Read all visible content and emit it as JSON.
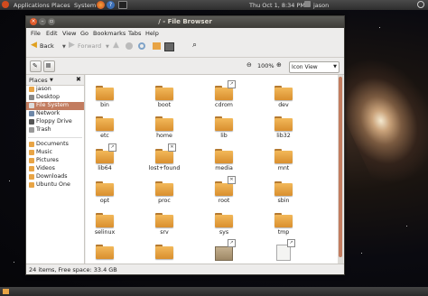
{
  "top_panel": {
    "menus": [
      "Applications",
      "Places",
      "System"
    ],
    "datetime": "Thu Oct 1,  8:34 PM",
    "user": "jason"
  },
  "window": {
    "title": "/ - File Browser",
    "menubar": [
      "File",
      "Edit",
      "View",
      "Go",
      "Bookmarks",
      "Tabs",
      "Help"
    ],
    "toolbar": {
      "back": "Back",
      "forward": "Forward"
    },
    "zoom": "100%",
    "view_mode": "Icon View",
    "sidebar": {
      "header": "Places",
      "items": [
        {
          "label": "jason",
          "icon": "home-icon"
        },
        {
          "label": "Desktop",
          "icon": "desktop-icon"
        },
        {
          "label": "File System",
          "icon": "drive-icon",
          "selected": true
        },
        {
          "label": "Network",
          "icon": "network-icon"
        },
        {
          "label": "Floppy Drive",
          "icon": "floppy-icon"
        },
        {
          "label": "Trash",
          "icon": "trash-icon"
        }
      ],
      "bookmarks": [
        {
          "label": "Documents"
        },
        {
          "label": "Music"
        },
        {
          "label": "Pictures"
        },
        {
          "label": "Videos"
        },
        {
          "label": "Downloads"
        },
        {
          "label": "Ubuntu One"
        }
      ]
    },
    "files": [
      {
        "name": "bin"
      },
      {
        "name": "boot"
      },
      {
        "name": "cdrom",
        "emblem": true
      },
      {
        "name": "dev"
      },
      {
        "name": "etc"
      },
      {
        "name": "home"
      },
      {
        "name": "lib"
      },
      {
        "name": "lib32"
      },
      {
        "name": "lib64",
        "emblem": true
      },
      {
        "name": "lost+found",
        "emblem": "x"
      },
      {
        "name": "media"
      },
      {
        "name": "mnt"
      },
      {
        "name": "opt"
      },
      {
        "name": "proc"
      },
      {
        "name": "root",
        "emblem": "x"
      },
      {
        "name": "sbin"
      },
      {
        "name": "selinux"
      },
      {
        "name": "srv"
      },
      {
        "name": "sys"
      },
      {
        "name": "tmp"
      },
      {
        "name": "",
        "type": "folder"
      },
      {
        "name": "",
        "type": "folder"
      },
      {
        "name": "",
        "type": "package",
        "emblem": true
      },
      {
        "name": "",
        "type": "document",
        "emblem": true
      }
    ],
    "status": "24 items, Free space: 33.4 GB"
  },
  "colors": {
    "accent": "#c27c5f",
    "folder": "#e8a445",
    "titlebar": "#3c3b37"
  }
}
